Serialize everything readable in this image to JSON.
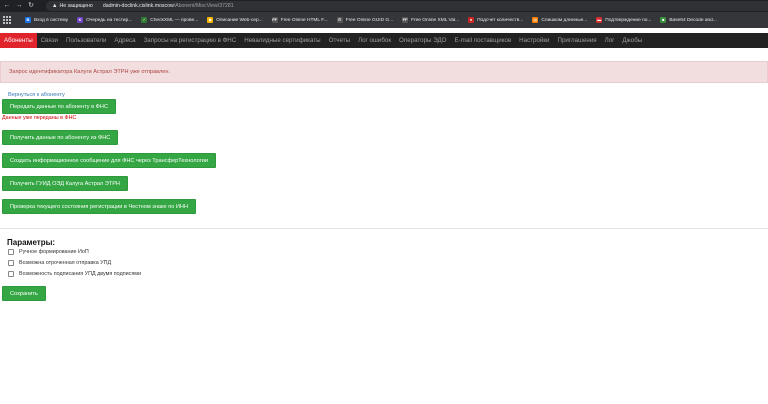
{
  "browser": {
    "insecure_label": "Не защищено",
    "url_host": "dadmin-doclink.cislink.moscow",
    "url_path": "/Abonent/MiscView/37281",
    "bookmarks": [
      {
        "label": "Вход в систему",
        "icon": "bookmark-b-icon",
        "color": "#1a73e8",
        "glyph": "B"
      },
      {
        "label": "Очередь на тестир...",
        "icon": "bookmark-k-icon",
        "color": "#6f42c1",
        "glyph": "K"
      },
      {
        "label": "CheckXML — прове...",
        "icon": "bookmark-doc-icon",
        "color": "#2e7d32",
        "glyph": "✓"
      },
      {
        "label": "Описание Web-сер...",
        "icon": "bookmark-puzzle-icon",
        "color": "#f4b400",
        "glyph": "◆"
      },
      {
        "label": "Free Online HTML F...",
        "icon": "bookmark-ff-icon",
        "color": "#555",
        "glyph": "FF"
      },
      {
        "label": "Free Online GUID G...",
        "icon": "bookmark-gear-icon",
        "color": "#555",
        "glyph": "⚙"
      },
      {
        "label": "Free Online XML Val...",
        "icon": "bookmark-ff-icon",
        "color": "#555",
        "glyph": "FF"
      },
      {
        "label": "Подсчет количеств...",
        "icon": "bookmark-circle-icon",
        "color": "#c62828",
        "glyph": "●"
      },
      {
        "label": "Слишком длинные...",
        "icon": "bookmark-table-icon",
        "color": "#f57c00",
        "glyph": "▤"
      },
      {
        "label": "Подтверждение по...",
        "icon": "bookmark-flag-icon",
        "color": "#d32f2f",
        "glyph": "▬"
      },
      {
        "label": "Base64 Decode and...",
        "icon": "bookmark-square-icon",
        "color": "#388e3c",
        "glyph": "■"
      }
    ]
  },
  "nav": [
    "Абоненты",
    "Связи",
    "Пользователи",
    "Адреса",
    "Запросы на регистрацию в ФНС",
    "Невалидные сертификаты",
    "Отчеты",
    "Лог ошибок",
    "Операторы ЭДО",
    "E-mail поставщиков",
    "Настройки",
    "Приглашения",
    "Лог",
    "Джобы"
  ],
  "alert": "Запрос идентификатора Калуги Астрал ЭТРН уже отправлен.",
  "back_link": "Вернуться к абоненту",
  "buttons": {
    "send_fns": "Передать данные по абоненту в ФНС",
    "get_fns": "Получить данные по абоненту из ФНС",
    "create_info": "Создать информационное сообщение для ФНС через ТрансферТехнологии",
    "get_guid": "Получить ГУИД ОЭД Калуга Астрал ЭТРН",
    "check_status": "Проверка текущего состояния регистрации в Честном знаке по ИНН",
    "save": "Сохранить"
  },
  "error_text": "Данные уже переданы в ФНС",
  "params": {
    "title": "Параметры:",
    "options": [
      "Ручное формирование ИоП",
      "Возможна отроченная отправка УПД",
      "Возможность подписания УПД двумя подписями"
    ]
  },
  "colors": {
    "accent_red": "#e0242c",
    "button_green": "#34a643",
    "alert_bg": "#f2dede",
    "alert_text": "#a94442"
  }
}
